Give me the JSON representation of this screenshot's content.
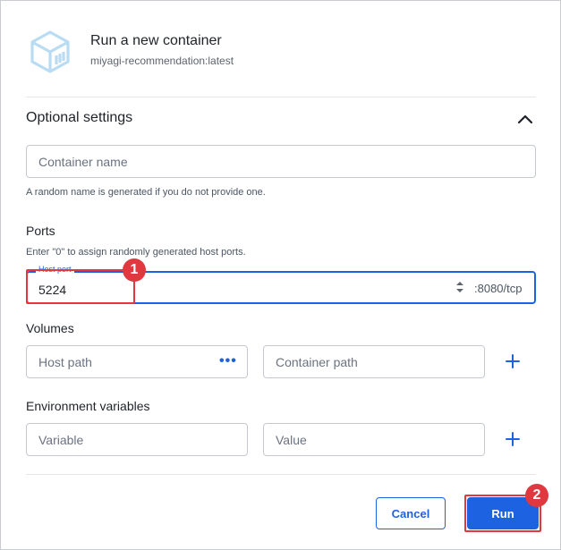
{
  "header": {
    "title": "Run a new container",
    "image_name": "miyagi-recommendation:latest"
  },
  "optional_settings": {
    "title": "Optional settings",
    "container_name": {
      "placeholder": "Container name",
      "value": ""
    },
    "container_name_hint": "A random name is generated if you do not provide one."
  },
  "ports": {
    "title": "Ports",
    "hint": "Enter \"0\" to assign randomly generated host ports.",
    "host_port_label": "Host port",
    "host_port_value": "5224",
    "container_port": ":8080/tcp"
  },
  "volumes": {
    "title": "Volumes",
    "host_path_placeholder": "Host path",
    "container_path_placeholder": "Container path"
  },
  "env": {
    "title": "Environment variables",
    "variable_placeholder": "Variable",
    "value_placeholder": "Value"
  },
  "actions": {
    "cancel_label": "Cancel",
    "run_label": "Run"
  },
  "annotations": {
    "badge_1": "1",
    "badge_2": "2"
  },
  "colors": {
    "accent": "#1d62e0",
    "highlight": "#e0383e"
  },
  "icons": {
    "logo": "container-cube-icon",
    "collapse": "chevron-up-icon",
    "browse": "more-horizontal-icon",
    "add": "plus-icon",
    "spinner": "up-down-arrows-icon"
  }
}
